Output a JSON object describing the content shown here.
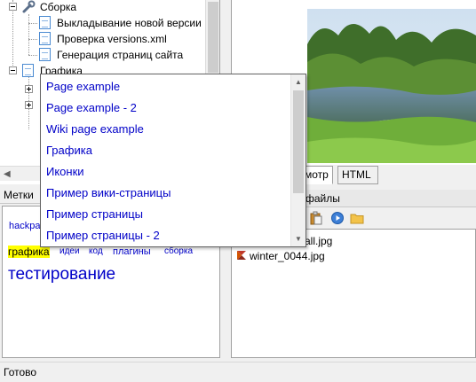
{
  "tree": {
    "items": [
      {
        "label": "Сборка"
      },
      {
        "label": "Выкладывание новой версии"
      },
      {
        "label": "Проверка versions.xml"
      },
      {
        "label": "Генерация страниц сайта"
      },
      {
        "label": "Графика"
      }
    ]
  },
  "popup": {
    "items": [
      {
        "label": "Page example"
      },
      {
        "label": "Page example - 2"
      },
      {
        "label": "Wiki page example"
      },
      {
        "label": "Графика"
      },
      {
        "label": "Иконки"
      },
      {
        "label": "Пример вики-страницы"
      },
      {
        "label": "Пример страницы"
      },
      {
        "label": "Пример страницы - 2"
      }
    ]
  },
  "tags": {
    "header": "Метки",
    "items": [
      {
        "label": "hackpa"
      },
      {
        "label": "графика"
      },
      {
        "label": "идеи"
      },
      {
        "label": "код"
      },
      {
        "label": "плагины"
      },
      {
        "label": "сборка"
      },
      {
        "label": "тестирование"
      }
    ],
    "highlight_color": "#ffff00"
  },
  "preview_tabs": [
    {
      "label": "мотр"
    },
    {
      "label": "HTML"
    }
  ],
  "files": {
    "header": "файлы",
    "items": [
      {
        "label": "all.jpg"
      },
      {
        "label": "winter_0044.jpg"
      }
    ]
  },
  "status": {
    "text": "Готово"
  },
  "colors": {
    "link": "#0000c8",
    "accent": "#4a8ad1"
  }
}
